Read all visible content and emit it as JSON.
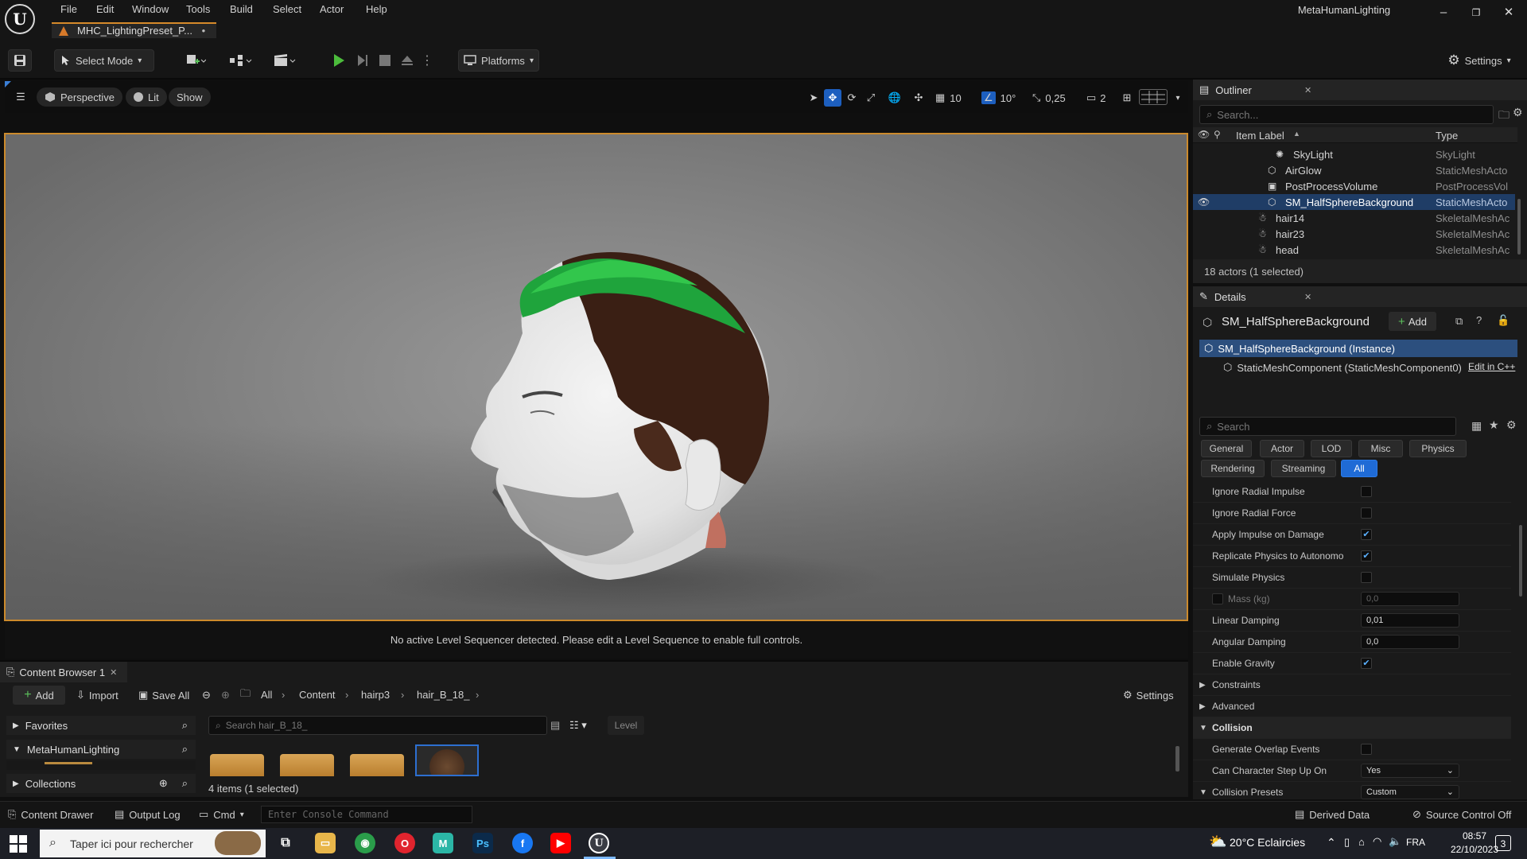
{
  "titlebar": {
    "menus": [
      "File",
      "Edit",
      "Window",
      "Tools",
      "Build",
      "Select",
      "Actor",
      "Help"
    ],
    "document_tab": "MHC_LightingPreset_P...",
    "unsaved_marker": "•",
    "project_name": "MetaHumanLighting"
  },
  "toolbar": {
    "mode_label": "Select Mode",
    "platforms_label": "Platforms",
    "settings_label": "Settings"
  },
  "viewport": {
    "perspective_label": "Perspective",
    "lit_label": "Lit",
    "show_label": "Show",
    "grid_snap": "10",
    "rotation_snap": "10°",
    "scale_snap": "0,25",
    "camera_speed": "2",
    "sequencer_message": "No active Level Sequencer detected. Please edit a Level Sequence to enable full controls."
  },
  "outliner": {
    "title": "Outliner",
    "search_placeholder": "Search...",
    "col_label": "Item Label",
    "col_type": "Type",
    "rows": [
      {
        "label": "SkyLight",
        "type": "SkyLight"
      },
      {
        "label": "AirGlow",
        "type": "StaticMeshActo"
      },
      {
        "label": "PostProcessVolume",
        "type": "PostProcessVol"
      },
      {
        "label": "SM_HalfSphereBackground",
        "type": "StaticMeshActo"
      },
      {
        "label": "hair14",
        "type": "SkeletalMeshAc"
      },
      {
        "label": "hair23",
        "type": "SkeletalMeshAc"
      },
      {
        "label": "head",
        "type": "SkeletalMeshAc"
      }
    ],
    "selected_index": 3,
    "summary": "18 actors (1 selected)"
  },
  "details": {
    "title": "Details",
    "actor_name": "SM_HalfSphereBackground",
    "add_label": "Add",
    "instance_label": "SM_HalfSphereBackground (Instance)",
    "component_label": "StaticMeshComponent (StaticMeshComponent0)",
    "edit_cpp_label": "Edit in C++",
    "search_placeholder": "Search",
    "categories_row1": [
      "General",
      "Actor",
      "LOD",
      "Misc",
      "Physics"
    ],
    "categories_row2": [
      "Rendering",
      "Streaming",
      "All"
    ],
    "active_category": "All",
    "props": {
      "ignore_radial_impulse": "Ignore Radial Impulse",
      "ignore_radial_force": "Ignore Radial Force",
      "apply_impulse": "Apply Impulse on Damage",
      "replicate_physics": "Replicate Physics to Autonomou...",
      "simulate_physics": "Simulate Physics",
      "mass_label": "Mass (kg)",
      "mass_value": "0,0",
      "linear_damping": "Linear Damping",
      "linear_damping_value": "0,01",
      "angular_damping": "Angular Damping",
      "angular_damping_value": "0,0",
      "enable_gravity": "Enable Gravity",
      "constraints": "Constraints",
      "advanced": "Advanced",
      "collision": "Collision",
      "generate_overlap": "Generate Overlap Events",
      "can_step_up": "Can Character Step Up On",
      "can_step_up_value": "Yes",
      "collision_presets": "Collision Presets",
      "collision_presets_value": "Custom"
    }
  },
  "content_browser": {
    "tab_label": "Content Browser 1",
    "add_label": "Add",
    "import_label": "Import",
    "save_all_label": "Save All",
    "breadcrumbs": [
      "All",
      "Content",
      "hairp3",
      "hair_B_18_"
    ],
    "settings_label": "Settings",
    "favorites_label": "Favorites",
    "project_label": "MetaHumanLighting",
    "collections_label": "Collections",
    "search_placeholder": "Search hair_B_18_",
    "filter_label": "Level",
    "item_count": "4 items (1 selected)"
  },
  "statusbar": {
    "content_drawer": "Content Drawer",
    "output_log": "Output Log",
    "cmd_label": "Cmd",
    "console_placeholder": "Enter Console Command",
    "derived_data": "Derived Data",
    "source_control": "Source Control Off"
  },
  "taskbar": {
    "search_placeholder": "Taper ici pour rechercher",
    "weather": "20°C  Eclaircies",
    "lang": "FRA",
    "time": "08:57",
    "date": "22/10/2023",
    "notif_count": "3"
  }
}
